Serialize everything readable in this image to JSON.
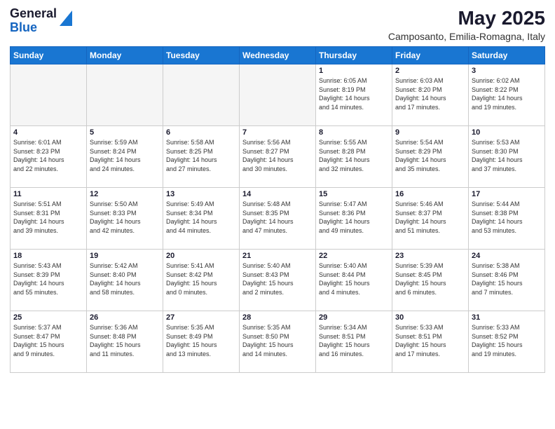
{
  "logo": {
    "general": "General",
    "blue": "Blue"
  },
  "title": "May 2025",
  "subtitle": "Camposanto, Emilia-Romagna, Italy",
  "days_of_week": [
    "Sunday",
    "Monday",
    "Tuesday",
    "Wednesday",
    "Thursday",
    "Friday",
    "Saturday"
  ],
  "weeks": [
    [
      {
        "day": "",
        "info": ""
      },
      {
        "day": "",
        "info": ""
      },
      {
        "day": "",
        "info": ""
      },
      {
        "day": "",
        "info": ""
      },
      {
        "day": "1",
        "info": "Sunrise: 6:05 AM\nSunset: 8:19 PM\nDaylight: 14 hours\nand 14 minutes."
      },
      {
        "day": "2",
        "info": "Sunrise: 6:03 AM\nSunset: 8:20 PM\nDaylight: 14 hours\nand 17 minutes."
      },
      {
        "day": "3",
        "info": "Sunrise: 6:02 AM\nSunset: 8:22 PM\nDaylight: 14 hours\nand 19 minutes."
      }
    ],
    [
      {
        "day": "4",
        "info": "Sunrise: 6:01 AM\nSunset: 8:23 PM\nDaylight: 14 hours\nand 22 minutes."
      },
      {
        "day": "5",
        "info": "Sunrise: 5:59 AM\nSunset: 8:24 PM\nDaylight: 14 hours\nand 24 minutes."
      },
      {
        "day": "6",
        "info": "Sunrise: 5:58 AM\nSunset: 8:25 PM\nDaylight: 14 hours\nand 27 minutes."
      },
      {
        "day": "7",
        "info": "Sunrise: 5:56 AM\nSunset: 8:27 PM\nDaylight: 14 hours\nand 30 minutes."
      },
      {
        "day": "8",
        "info": "Sunrise: 5:55 AM\nSunset: 8:28 PM\nDaylight: 14 hours\nand 32 minutes."
      },
      {
        "day": "9",
        "info": "Sunrise: 5:54 AM\nSunset: 8:29 PM\nDaylight: 14 hours\nand 35 minutes."
      },
      {
        "day": "10",
        "info": "Sunrise: 5:53 AM\nSunset: 8:30 PM\nDaylight: 14 hours\nand 37 minutes."
      }
    ],
    [
      {
        "day": "11",
        "info": "Sunrise: 5:51 AM\nSunset: 8:31 PM\nDaylight: 14 hours\nand 39 minutes."
      },
      {
        "day": "12",
        "info": "Sunrise: 5:50 AM\nSunset: 8:33 PM\nDaylight: 14 hours\nand 42 minutes."
      },
      {
        "day": "13",
        "info": "Sunrise: 5:49 AM\nSunset: 8:34 PM\nDaylight: 14 hours\nand 44 minutes."
      },
      {
        "day": "14",
        "info": "Sunrise: 5:48 AM\nSunset: 8:35 PM\nDaylight: 14 hours\nand 47 minutes."
      },
      {
        "day": "15",
        "info": "Sunrise: 5:47 AM\nSunset: 8:36 PM\nDaylight: 14 hours\nand 49 minutes."
      },
      {
        "day": "16",
        "info": "Sunrise: 5:46 AM\nSunset: 8:37 PM\nDaylight: 14 hours\nand 51 minutes."
      },
      {
        "day": "17",
        "info": "Sunrise: 5:44 AM\nSunset: 8:38 PM\nDaylight: 14 hours\nand 53 minutes."
      }
    ],
    [
      {
        "day": "18",
        "info": "Sunrise: 5:43 AM\nSunset: 8:39 PM\nDaylight: 14 hours\nand 55 minutes."
      },
      {
        "day": "19",
        "info": "Sunrise: 5:42 AM\nSunset: 8:40 PM\nDaylight: 14 hours\nand 58 minutes."
      },
      {
        "day": "20",
        "info": "Sunrise: 5:41 AM\nSunset: 8:42 PM\nDaylight: 15 hours\nand 0 minutes."
      },
      {
        "day": "21",
        "info": "Sunrise: 5:40 AM\nSunset: 8:43 PM\nDaylight: 15 hours\nand 2 minutes."
      },
      {
        "day": "22",
        "info": "Sunrise: 5:40 AM\nSunset: 8:44 PM\nDaylight: 15 hours\nand 4 minutes."
      },
      {
        "day": "23",
        "info": "Sunrise: 5:39 AM\nSunset: 8:45 PM\nDaylight: 15 hours\nand 6 minutes."
      },
      {
        "day": "24",
        "info": "Sunrise: 5:38 AM\nSunset: 8:46 PM\nDaylight: 15 hours\nand 7 minutes."
      }
    ],
    [
      {
        "day": "25",
        "info": "Sunrise: 5:37 AM\nSunset: 8:47 PM\nDaylight: 15 hours\nand 9 minutes."
      },
      {
        "day": "26",
        "info": "Sunrise: 5:36 AM\nSunset: 8:48 PM\nDaylight: 15 hours\nand 11 minutes."
      },
      {
        "day": "27",
        "info": "Sunrise: 5:35 AM\nSunset: 8:49 PM\nDaylight: 15 hours\nand 13 minutes."
      },
      {
        "day": "28",
        "info": "Sunrise: 5:35 AM\nSunset: 8:50 PM\nDaylight: 15 hours\nand 14 minutes."
      },
      {
        "day": "29",
        "info": "Sunrise: 5:34 AM\nSunset: 8:51 PM\nDaylight: 15 hours\nand 16 minutes."
      },
      {
        "day": "30",
        "info": "Sunrise: 5:33 AM\nSunset: 8:51 PM\nDaylight: 15 hours\nand 17 minutes."
      },
      {
        "day": "31",
        "info": "Sunrise: 5:33 AM\nSunset: 8:52 PM\nDaylight: 15 hours\nand 19 minutes."
      }
    ]
  ],
  "colors": {
    "header_bg": "#1976d2",
    "alt_row_bg": "#edf2f7"
  }
}
